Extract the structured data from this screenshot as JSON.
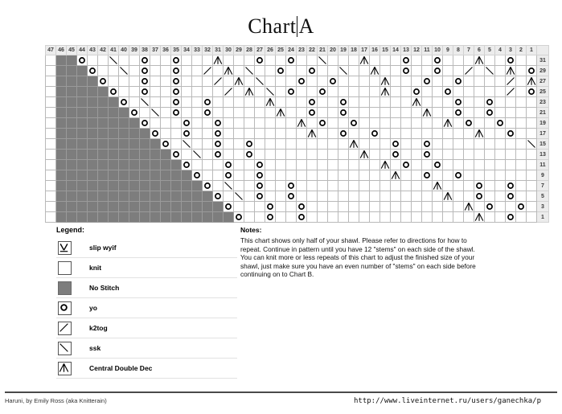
{
  "title": {
    "main": "Chart",
    "suffix": "A"
  },
  "chart_data": {
    "type": "table",
    "title": "Chart A",
    "description": "Knitting stitch chart grid, 47 columns numbered right-to-left, 31 rows numbered bottom-to-top (odd rows shown).",
    "col_count": 47,
    "row_count": 31,
    "col_labels": [
      47,
      46,
      45,
      44,
      43,
      42,
      41,
      40,
      39,
      38,
      37,
      36,
      35,
      34,
      33,
      32,
      31,
      30,
      29,
      28,
      27,
      26,
      25,
      24,
      23,
      22,
      21,
      20,
      19,
      18,
      17,
      16,
      15,
      14,
      13,
      12,
      11,
      10,
      9,
      8,
      7,
      6,
      5,
      4,
      3,
      2,
      1
    ],
    "row_labels": [
      31,
      29,
      27,
      25,
      23,
      21,
      19,
      17,
      15,
      13,
      11,
      9,
      7,
      5,
      3,
      1
    ],
    "symbol_key": {
      "k": "knit",
      "n": "No Stitch",
      "o": "yo",
      "/": "k2tog",
      "\\": "ssk",
      "A": "Central Double Dec",
      "V": "slip wyif"
    },
    "colors": {
      "no_stitch": "#7d7d7d",
      "grid": "#b9b9b9",
      "header": "#ececec",
      "ink": "#111111"
    },
    "rows": [
      {
        "label": "31",
        "cells": "knnokk\\kkokkokkkAkkkokkokk\\kkkAkkkokkokkkAkkokkokk/konnV"
      },
      {
        "label": "29",
        "cells": "knnnokk\\kokkokk/kAk\\kkokkokk\\kkAkkokkokk/k\\kAkokkokk/koknnV"
      },
      {
        "label": "27",
        "cells": "knnnnokkkokkokkk/kAk\\kkkokkokkkkAkkkokkokkkk/kAkokknnV"
      },
      {
        "label": "25",
        "cells": "knnnnnokkokkokkkk/kAk\\kokkokkkkkAkkokkokkkkk/kokknnV"
      },
      {
        "label": "23",
        "cells": "knnnnnnok\\kkokkokkkkkAkkkokkokkkkkkAkkkokkokkkkk\\konnV"
      },
      {
        "label": "21",
        "cells": "knnnnnnnok\\kokkokkkkkkAkkokkokkkkkkkAkkokkokkkkkk\\konnV"
      },
      {
        "label": "19",
        "cells": "knnnnnnnnokkkokkokkkkkkkAkokkokkkkkkkkAkokkokkkkkkkknnV"
      },
      {
        "label": "17",
        "cells": "knnnnnnnnnokkokkokkkkkkkkAkkokkokkkkkkkkkAkkokknnV"
      },
      {
        "label": "15",
        "cells": "knnnnnnnnnnok\\kkokkokkkkkkkkkAkkkokkokkkkkkkkk\\konnV"
      },
      {
        "label": "13",
        "cells": "knnnnnnnnnnnok\\kokkokkkkkkkkkkAkkokkokkkkkkkkkk\\konnV"
      },
      {
        "label": "11",
        "cells": "knnnnnnnnnnnnokkkokkokkkkkkkkkkkAkokkokkkkkkkkkkknnV"
      },
      {
        "label": "9",
        "cells": "knnnnnnnnnnnnnokkokkokkkkkkkkkkkkAkkokkokkkkkkkkkknnV"
      },
      {
        "label": "7",
        "cells": "knnnnnnnnnnnnnnok\\kkokkokkkkkkkkkkkkkAkkkokkokkkkkkk\\konnV"
      },
      {
        "label": "5",
        "cells": "knnnnnnnnnnnnnnnok\\kokkokkkkkkkkkkkkkkAkkokkokkkkkkkk\\konnV"
      },
      {
        "label": "3",
        "cells": "knnnnnnnnnnnnnnnnokkkokkokkkkkkkkkkkkkkkAkokkokkkkkkkkknnV"
      },
      {
        "label": "1",
        "cells": "knnnnnnnnnnnnnnnnnokkokkokkkkkkkkkkkkkkkkAkkokkokkkkkkkknnV"
      }
    ]
  },
  "legend": {
    "title": "Legend:",
    "items": [
      {
        "symbol": "V",
        "label": "slip wyif"
      },
      {
        "symbol": "k",
        "label": "knit"
      },
      {
        "symbol": "n",
        "label": "No Stitch"
      },
      {
        "symbol": "o",
        "label": "yo"
      },
      {
        "symbol": "/",
        "label": "k2tog"
      },
      {
        "symbol": "\\",
        "label": "ssk"
      },
      {
        "symbol": "A",
        "label": "Central Double Dec"
      }
    ]
  },
  "notes": {
    "title": "Notes:",
    "lines": [
      "This chart shows only half of your shawl. Please refer to directions for how to",
      "repeat. Continue in pattern until you have 12 \"stems\" on each side of the shawl.",
      "You can knit more or less repeats of this chart to adjust the finished size of your",
      "shawl, just make sure you have an even number of \"stems\" on each side before",
      "continuing on to Chart B."
    ]
  },
  "footer": {
    "left": "Haruni, by Emily Ross (aka Knitterain)",
    "right": "http://www.liveinternet.ru/users/ganechka/p"
  }
}
